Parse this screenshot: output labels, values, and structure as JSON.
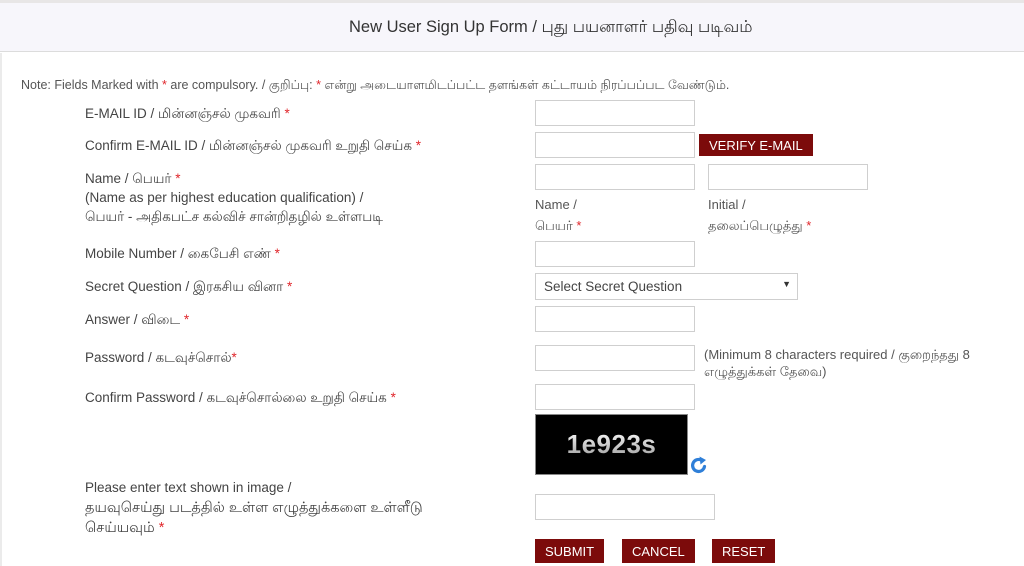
{
  "header": {
    "title": "New User Sign Up Form / புது பயனாளர் பதிவு படிவம்"
  },
  "note": {
    "prefix": "Note: Fields Marked with ",
    "star": "*",
    "middle": " are compulsory. / குறிப்பு: ",
    "star2": "*",
    "suffix": " என்று அடையாளமிடப்பட்ட தளங்கள் கட்டாயம் நிரப்பப்பட வேண்டும்."
  },
  "required_mark": "*",
  "fields": {
    "email": {
      "label": "E-MAIL ID / மின்னஞ்சல் முகவரி ",
      "value": ""
    },
    "confirm_email": {
      "label": "Confirm E-MAIL ID / மின்னஞ்சல் முகவரி உறுதி செய்க ",
      "value": ""
    },
    "name": {
      "label_line1": "Name / பெயர் ",
      "label_line2": "(Name as per highest education qualification) /",
      "label_line3": "பெயர் - அதிகபட்ச கல்விச் சான்றிதழில் உள்ளபடி",
      "name_value": "",
      "initial_value": "",
      "name_sub_line1": "Name /",
      "name_sub_line2": "பெயர் ",
      "initial_sub_line1": "Initial /",
      "initial_sub_line2": "தலைப்பெழுத்து "
    },
    "mobile": {
      "label": "Mobile Number / கைபேசி எண் ",
      "value": ""
    },
    "secret_question": {
      "label": "Secret Question / இரகசிய வினா ",
      "selected": "Select Secret Question"
    },
    "answer": {
      "label": "Answer / விடை ",
      "value": ""
    },
    "password": {
      "label": "Password / கடவுச்சொல்",
      "value": "",
      "hint": "(Minimum 8 characters required / குறைந்தது 8 எழுத்துக்கள் தேவை)"
    },
    "confirm_password": {
      "label": "Confirm Password / கடவுச்சொல்லை உறுதி செய்க ",
      "value": ""
    },
    "captcha": {
      "image_text": "1e923s",
      "label_line1": "Please enter text shown in image /",
      "label_line2": "தயவுசெய்து படத்தில் உள்ள எழுத்துக்களை உள்ளீடு",
      "label_line3": "செய்யவும் ",
      "value": ""
    }
  },
  "buttons": {
    "verify_email": "VERIFY E-MAIL",
    "submit": "SUBMIT",
    "cancel": "CANCEL",
    "reset": "RESET"
  },
  "icons": {
    "refresh": "refresh-captcha-icon",
    "dropdown": "chevron-down-icon"
  },
  "colors": {
    "button_bg": "#7c0b0b",
    "required_star": "#e0262b",
    "header_bg": "#f7f6fb"
  }
}
